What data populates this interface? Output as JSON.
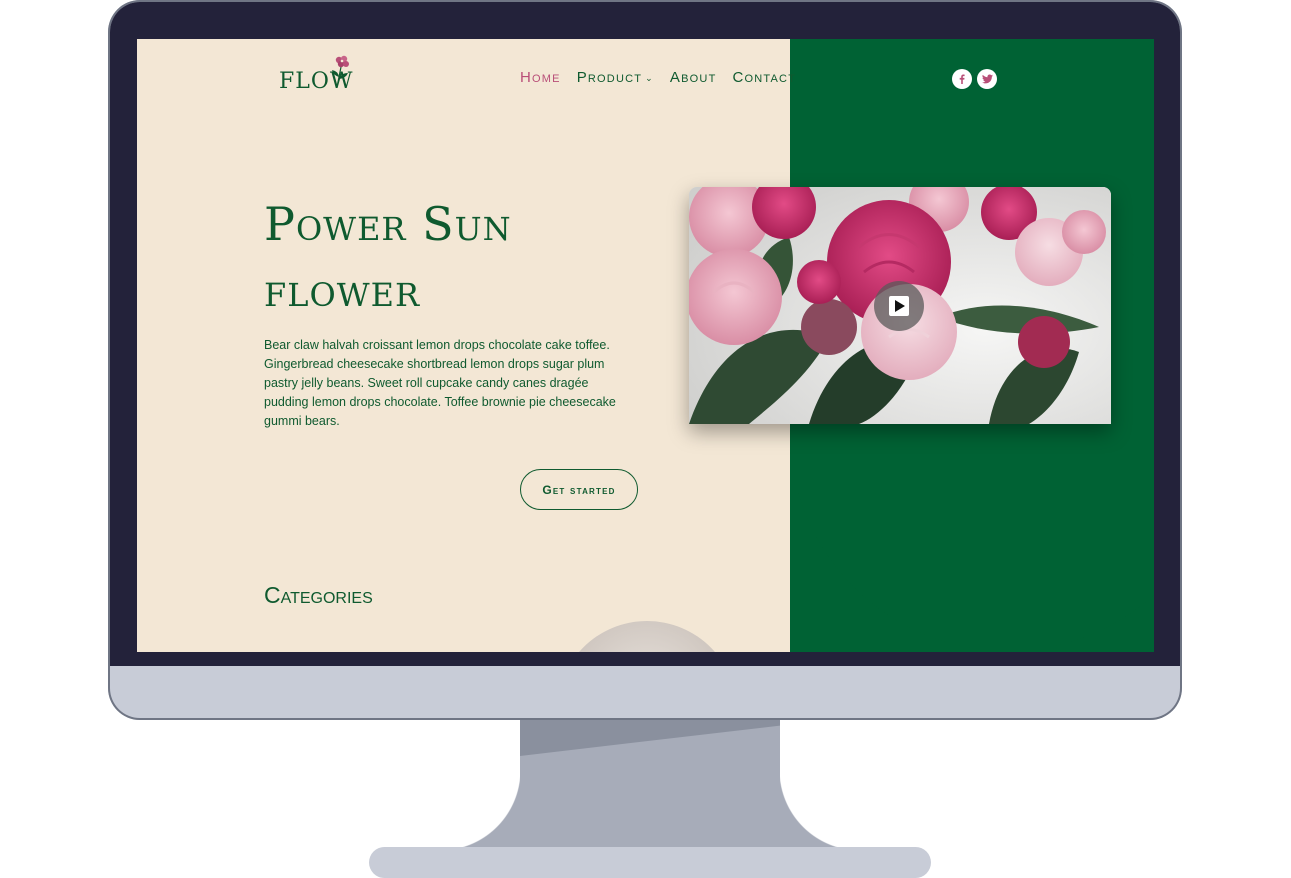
{
  "colors": {
    "brand_green": "#0f5a2f",
    "panel_green": "#006234",
    "accent_pink": "#b94f78",
    "cream": "#f3e7d5",
    "bezel": "#23223a"
  },
  "header": {
    "logo_text": "FLOW",
    "logo_icon": "flower-icon",
    "nav": [
      {
        "label": "Home",
        "active": true
      },
      {
        "label": "Product",
        "has_dropdown": true
      },
      {
        "label": "About"
      },
      {
        "label": "Contact"
      }
    ],
    "social": [
      {
        "icon": "facebook-icon"
      },
      {
        "icon": "twitter-icon"
      }
    ]
  },
  "hero": {
    "title_line1": "Power Sun",
    "title_line2": "flower",
    "description": "Bear claw halvah croissant lemon drops chocolate cake toffee. Gingerbread cheesecake shortbread lemon drops sugar plum pastry jelly beans. Sweet roll cupcake candy canes dragée pudding lemon drops chocolate. Toffee brownie pie cheesecake gummi bears.",
    "cta_label": "Get started",
    "video_icon": "play-icon"
  },
  "categories": {
    "heading": "Categories"
  }
}
